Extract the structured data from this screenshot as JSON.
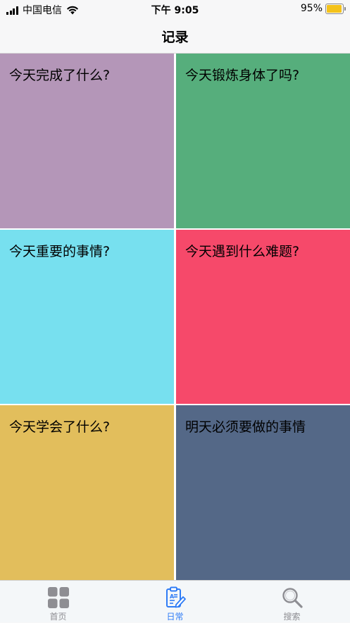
{
  "status_bar": {
    "carrier": "中国电信",
    "time": "下午 9:05",
    "battery_percent": "95%",
    "battery_level": 0.95,
    "battery_color": "#f4c21b"
  },
  "nav": {
    "title": "记录"
  },
  "tiles": [
    {
      "label": "今天完成了什么?",
      "color": "#b496b8"
    },
    {
      "label": "今天锻炼身体了吗?",
      "color": "#56ae7c"
    },
    {
      "label": "今天重要的事情?",
      "color": "#77e0ef"
    },
    {
      "label": "今天遇到什么难题?",
      "color": "#f6496a"
    },
    {
      "label": "今天学会了什么?",
      "color": "#e2be5c"
    },
    {
      "label": "明天必须要做的事情",
      "color": "#546887"
    }
  ],
  "tab_bar": {
    "tabs": [
      {
        "label": "首页",
        "icon": "grid-icon",
        "selected": false
      },
      {
        "label": "日常",
        "icon": "clipboard-edit-icon",
        "selected": true
      },
      {
        "label": "搜索",
        "icon": "search-icon",
        "selected": false
      }
    ],
    "active_color": "#2f7cf6",
    "inactive_color": "#8e8e93"
  }
}
